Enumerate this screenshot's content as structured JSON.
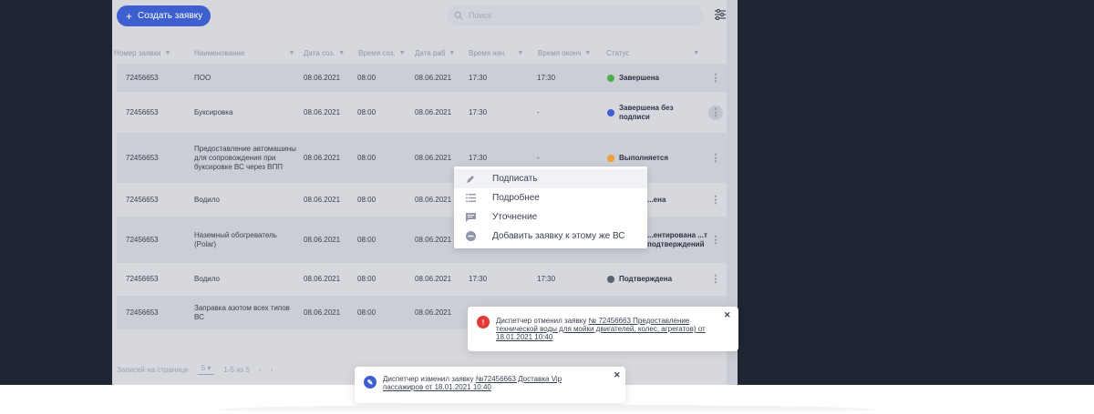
{
  "toolbar": {
    "create_label": "Создать заявку",
    "search_placeholder": "Поиск"
  },
  "columns": [
    {
      "label": "Номер заявки"
    },
    {
      "label": "Наименование"
    },
    {
      "label": "Дата соз."
    },
    {
      "label": "Время соз."
    },
    {
      "label": "Дата раб"
    },
    {
      "label": "Время нач."
    },
    {
      "label": "Время оконч"
    },
    {
      "label": "Статус"
    }
  ],
  "rows": [
    {
      "number": "72456653",
      "name": "ПОО",
      "date_created": "08.06.2021",
      "time_created": "08:00",
      "date_work": "08.06.2021",
      "time_start": "17:30",
      "time_end": "17:30",
      "status": "Завершена",
      "status_color": "#4caf50"
    },
    {
      "number": "72456653",
      "name": "Буксировка",
      "date_created": "08.06.2021",
      "time_created": "08:00",
      "date_work": "08.06.2021",
      "time_start": "17:30",
      "time_end": "-",
      "status": "Завершена без подписи",
      "status_color": "#3d5fcf"
    },
    {
      "number": "72456653",
      "name": "Предоставление автомашины для сопровождения при буксировке ВС через ВПП",
      "date_created": "08.06.2021",
      "time_created": "08:00",
      "date_work": "08.06.2021",
      "time_start": "17:30",
      "time_end": "-",
      "status": "Выполняется",
      "status_color": "#f0a030"
    },
    {
      "number": "72456653",
      "name": "Водило",
      "date_created": "08.06.2021",
      "time_created": "08:00",
      "date_work": "08.06.2021",
      "time_start": "",
      "time_end": "",
      "status": "...ена",
      "status_color": "#3d5fcf"
    },
    {
      "number": "72456653",
      "name": "Наземный обогреватель (Polar)",
      "date_created": "08.06.2021",
      "time_created": "08:00",
      "date_work": "08.06.2021",
      "time_start": "",
      "time_end": "",
      "status": "...ентирована ...т подтверждений",
      "status_color": "#f0a030"
    },
    {
      "number": "72456653",
      "name": "Водило",
      "date_created": "08.06.2021",
      "time_created": "08:00",
      "date_work": "08.06.2021",
      "time_start": "17:30",
      "time_end": "17:30",
      "status": "Подтверждена",
      "status_color": "#5a6272"
    },
    {
      "number": "72456653",
      "name": "Заправка азотом всех типов ВС",
      "date_created": "08.06.2021",
      "time_created": "08:00",
      "date_work": "08.06.2021",
      "time_start": "",
      "time_end": "",
      "status": "",
      "status_color": "#5a6272"
    }
  ],
  "pagination": {
    "per_page_label": "Записей на странице",
    "per_page_value": "5",
    "range": "1-5 из 5",
    "prev": "‹",
    "next": "›"
  },
  "context_menu": {
    "items": [
      {
        "label": "Подписать",
        "icon": "pencil-icon"
      },
      {
        "label": "Подробнее",
        "icon": "list-icon"
      },
      {
        "label": "Уточнение",
        "icon": "message-icon"
      },
      {
        "label": "Добавить заявку к этому же ВС",
        "icon": "add-circle-icon"
      }
    ]
  },
  "toasts": {
    "cancelled": {
      "prefix": "Диспетчер отменил заявку",
      "link": "№ 72456663 Предоставление технической воды для мойки двигателей, колес, агрегатов) от 18.01.2021 10:40",
      "icon_glyph": "!",
      "color": "#e53935"
    },
    "changed": {
      "prefix": "Диспетчер изменил заявку",
      "link": "№72456663 Доставка Vip пассажиров от 18.01.2021 10:40",
      "icon_glyph": "✎",
      "color": "#3d5fcf"
    },
    "close_glyph": "✕"
  }
}
